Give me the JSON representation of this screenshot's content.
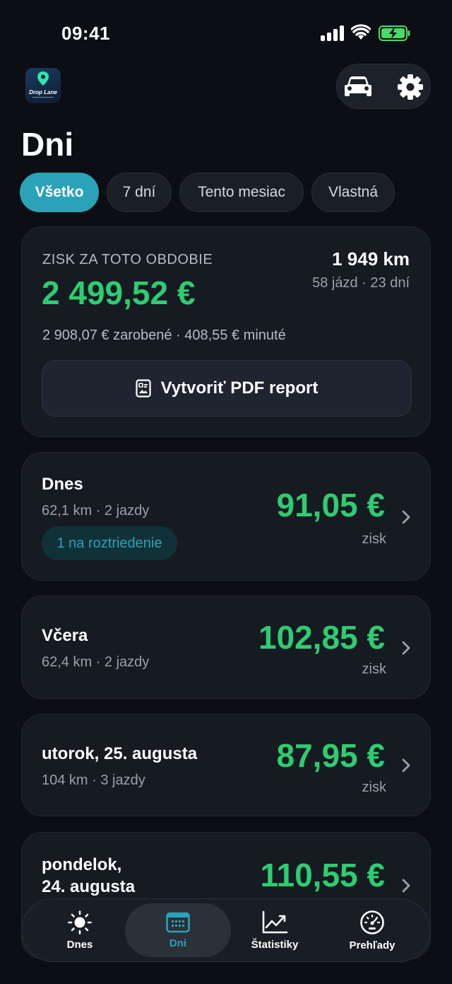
{
  "status_bar": {
    "time": "09:41"
  },
  "header": {
    "logo_text": "Drop Lane",
    "title": "Dni"
  },
  "filters": [
    {
      "label": "Všetko",
      "active": true
    },
    {
      "label": "7 dní",
      "active": false
    },
    {
      "label": "Tento mesiac",
      "active": false
    },
    {
      "label": "Vlastná",
      "active": false
    }
  ],
  "summary": {
    "label": "ZISK ZA TOTO OBDOBIE",
    "total": "2 499,52 €",
    "distance": "1 949 km",
    "trips_days": "58 jázd · 23 dní",
    "breakdown": "2 908,07 € zarobené · 408,55 € minuté",
    "pdf_button": "Vytvoriť PDF report"
  },
  "days": [
    {
      "title": "Dnes",
      "meta": "62,1 km · 2 jazdy",
      "amount": "91,05 €",
      "sub": "zisk",
      "badge": "1 na roztriedenie"
    },
    {
      "title": "Včera",
      "meta": "62,4 km · 2 jazdy",
      "amount": "102,85 €",
      "sub": "zisk"
    },
    {
      "title": "utorok, 25. augusta",
      "meta": "104 km · 3 jazdy",
      "amount": "87,95 €",
      "sub": "zisk"
    },
    {
      "title_line1": "pondelok,",
      "title_line2": "24. augusta",
      "amount": "110,55 €"
    }
  ],
  "tabs": [
    {
      "label": "Dnes",
      "icon": "sun-icon"
    },
    {
      "label": "Dni",
      "icon": "calendar-icon",
      "active": true
    },
    {
      "label": "Štatistiky",
      "icon": "chart-icon"
    },
    {
      "label": "Prehľady",
      "icon": "gauge-icon"
    }
  ],
  "colors": {
    "accent": "#2aa3b8",
    "profit": "#2ecc71",
    "background": "#0b0e13",
    "card": "#161a21"
  }
}
